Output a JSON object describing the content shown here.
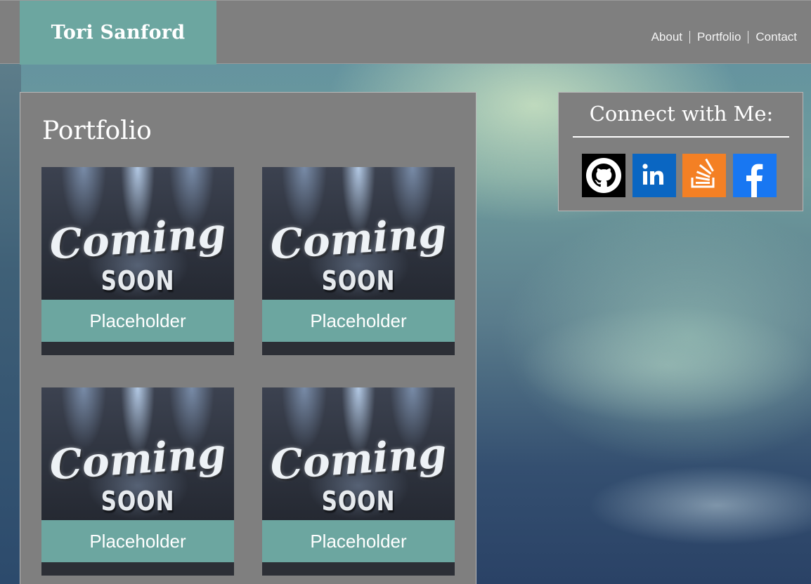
{
  "header": {
    "brand": "Tori Sanford",
    "nav": [
      {
        "label": "About"
      },
      {
        "label": "Portfolio"
      },
      {
        "label": "Contact"
      }
    ]
  },
  "portfolio": {
    "title": "Portfolio",
    "cards": [
      {
        "image_text_top": "Coming",
        "image_text_bottom": "SOON",
        "caption": "Placeholder"
      },
      {
        "image_text_top": "Coming",
        "image_text_bottom": "SOON",
        "caption": "Placeholder"
      },
      {
        "image_text_top": "Coming",
        "image_text_bottom": "SOON",
        "caption": "Placeholder"
      },
      {
        "image_text_top": "Coming",
        "image_text_bottom": "SOON",
        "caption": "Placeholder"
      }
    ]
  },
  "connect": {
    "title": "Connect with Me:",
    "links": [
      {
        "icon": "github-icon",
        "color": "#000000"
      },
      {
        "icon": "linkedin-icon",
        "color": "#0a66c2"
      },
      {
        "icon": "stackoverflow-icon",
        "color": "#f48024"
      },
      {
        "icon": "facebook-icon",
        "color": "#1877f2"
      }
    ]
  },
  "colors": {
    "header_bg": "#7f7f7f",
    "accent_teal": "#6ca6a0",
    "panel_bg": "#7f7f7f"
  }
}
